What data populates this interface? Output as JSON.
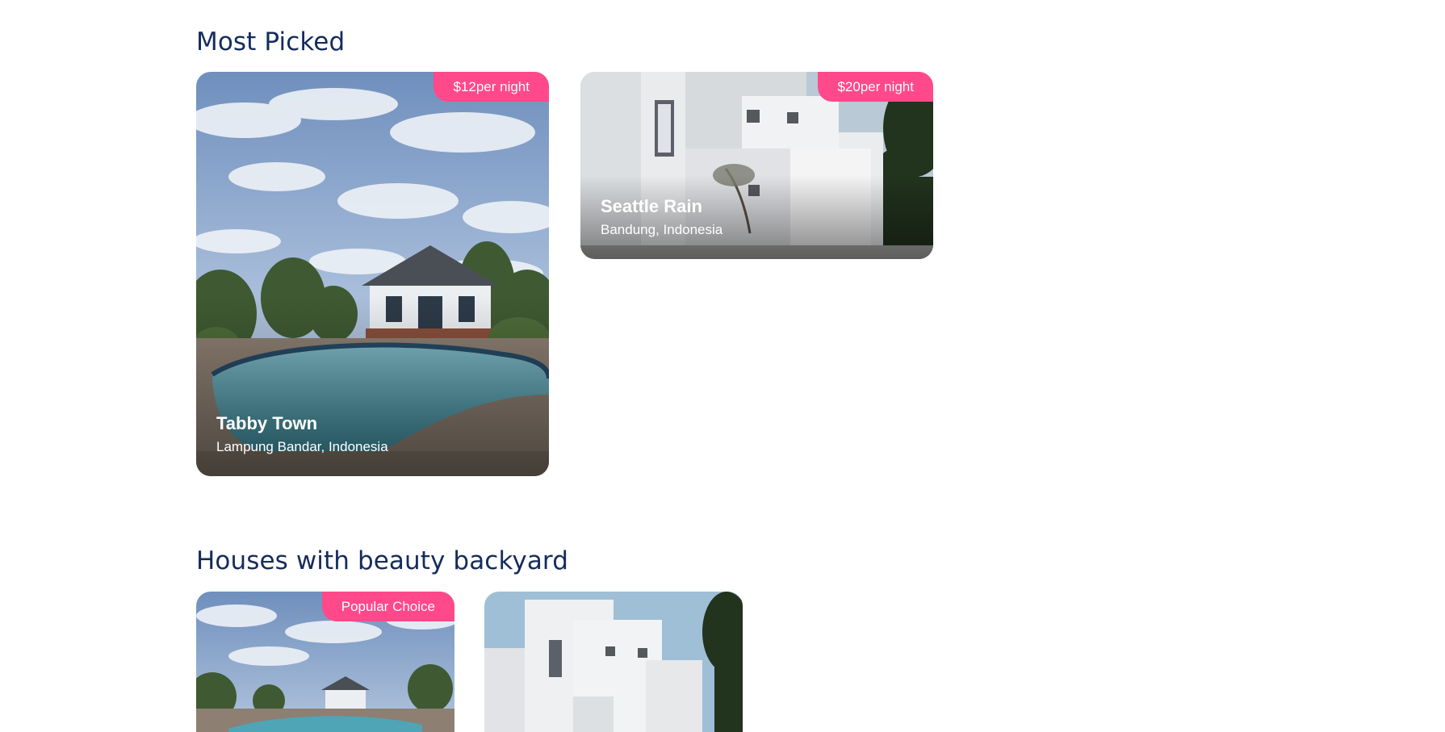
{
  "sections": {
    "most_picked": {
      "title": "Most Picked",
      "cards": [
        {
          "name": "Tabby Town",
          "location": "Lampung Bandar, Indonesia",
          "price": "$12",
          "unit": "per night",
          "image": "house-with-pool-photo"
        },
        {
          "name": "Seattle Rain",
          "location": "Bandung, Indonesia",
          "price": "$20",
          "unit": "per night",
          "image": "white-modern-house-photo"
        }
      ]
    },
    "backyard": {
      "title": "Houses with beauty backyard",
      "cards": [
        {
          "badge_strong": "Popular",
          "badge_light": "Choice",
          "image": "house-with-pool-photo"
        },
        {
          "image": "white-modern-house-photo"
        }
      ]
    }
  },
  "colors": {
    "title": "#152c5b",
    "accent": "#ff498b",
    "background": "#ffffff"
  }
}
